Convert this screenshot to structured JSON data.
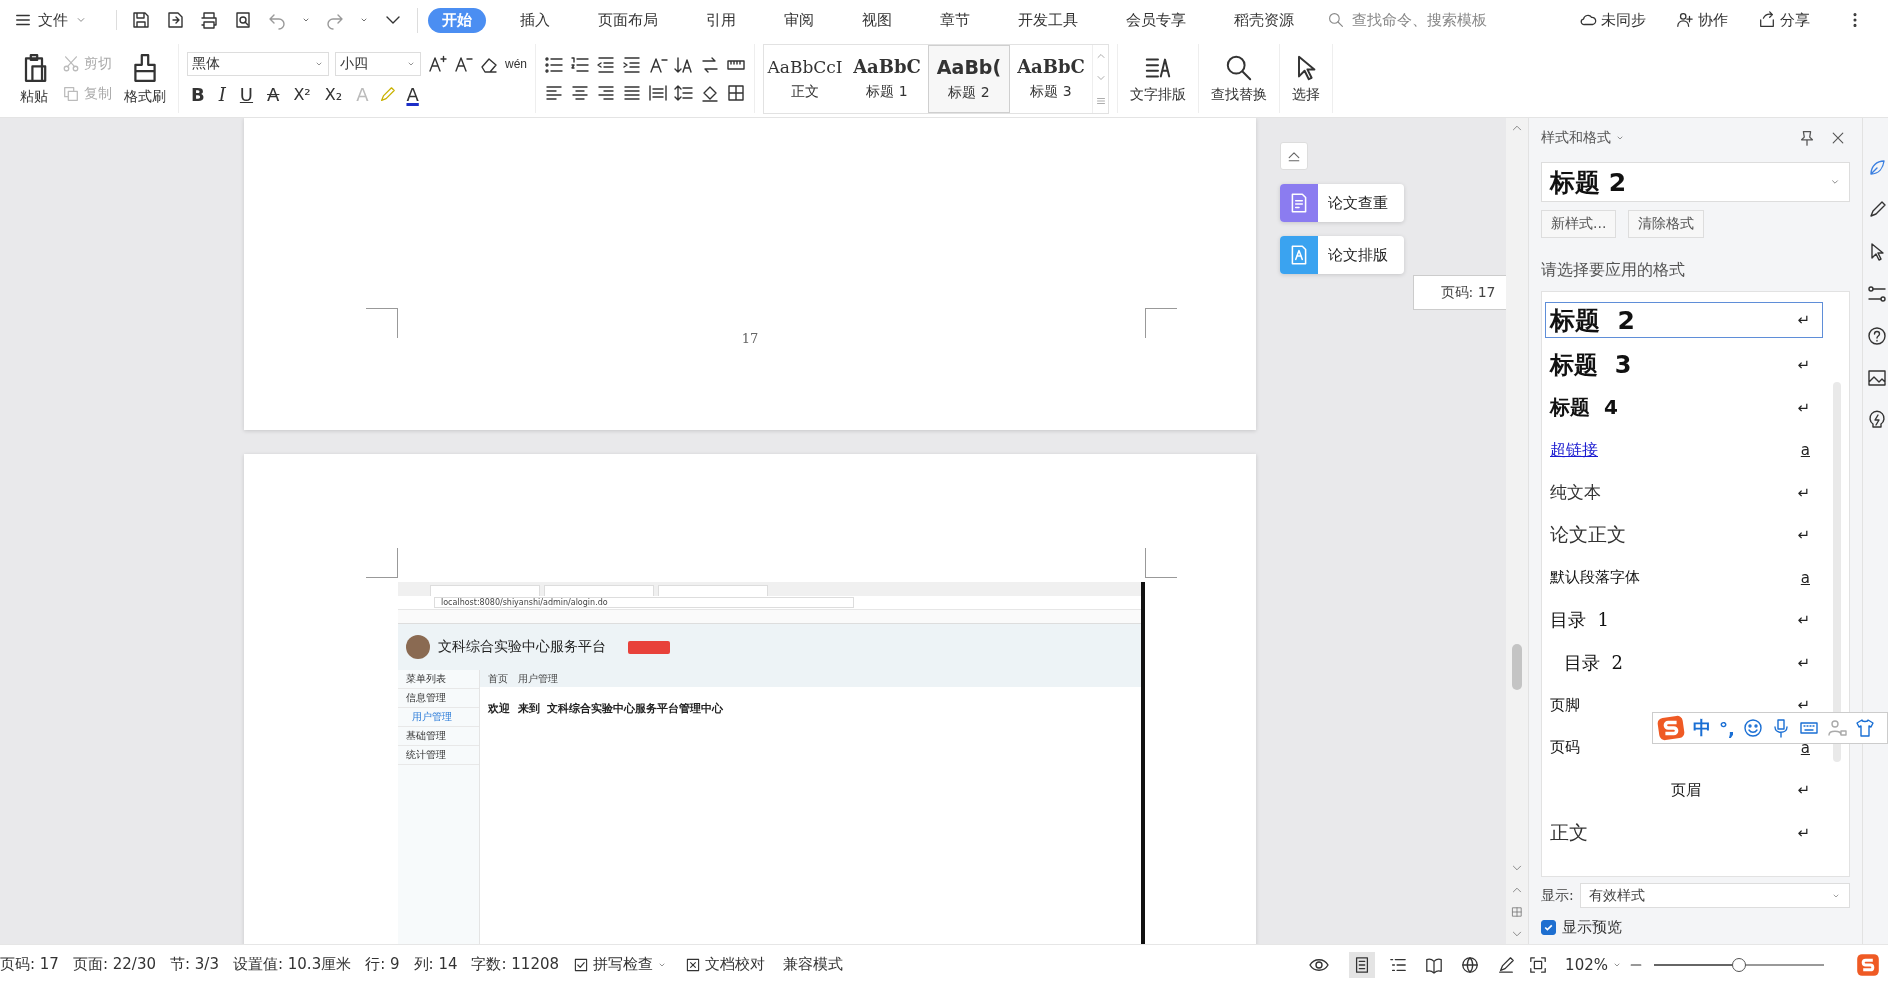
{
  "menu_bar": {
    "file_menu": "文件",
    "tabs": [
      {
        "label": "开始",
        "selected": true
      },
      {
        "label": "插入",
        "selected": false
      },
      {
        "label": "页面布局",
        "selected": false
      },
      {
        "label": "引用",
        "selected": false
      },
      {
        "label": "审阅",
        "selected": false
      },
      {
        "label": "视图",
        "selected": false
      },
      {
        "label": "章节",
        "selected": false
      },
      {
        "label": "开发工具",
        "selected": false
      },
      {
        "label": "会员专享",
        "selected": false
      },
      {
        "label": "稻壳资源",
        "selected": false
      }
    ],
    "search": {
      "placeholder": "查找命令、搜索模板"
    },
    "actions": [
      {
        "kind": "cloud",
        "label": "未同步"
      },
      {
        "kind": "collab",
        "label": "协作"
      },
      {
        "kind": "share",
        "label": "分享"
      }
    ]
  },
  "ribbon": {
    "clipboard": [
      {
        "kind": "paste",
        "label": "粘贴",
        "disabled": false
      },
      {
        "kind": "cut",
        "label": "剪切",
        "disabled": true
      },
      {
        "kind": "copy",
        "label": "复制",
        "disabled": true
      },
      {
        "kind": "painter",
        "label": "格式刷",
        "disabled": false
      }
    ],
    "font": {
      "name": "黑体",
      "size": "小四"
    },
    "phonetic": "wén",
    "format_glyphs": [
      "B",
      "I",
      "U",
      "A",
      "X²",
      "X₂",
      "A",
      "A"
    ],
    "styles": [
      {
        "preview": "AaBbCcI",
        "label": "正文",
        "kind": "body",
        "selected": false
      },
      {
        "preview": "AaBbC",
        "label": "标题 1",
        "kind": "h1",
        "selected": false
      },
      {
        "preview": "AaBb(",
        "label": "标题 2",
        "kind": "h2",
        "selected": true
      },
      {
        "preview": "AaBbC",
        "label": "标题 3",
        "kind": "h3",
        "selected": false
      }
    ],
    "buttons": [
      {
        "kind": "layout",
        "label": "文字排版"
      },
      {
        "kind": "find",
        "label": "查找替换"
      },
      {
        "kind": "select",
        "label": "选择"
      }
    ]
  },
  "document": {
    "page_number": "17",
    "side_tools": [
      {
        "kind": "check",
        "label": "论文查重"
      },
      {
        "kind": "format",
        "label": "论文排版"
      }
    ],
    "tooltip": "页码: 17",
    "screenshot": {
      "url": "localhost:8080/shiyanshi/admin/alogin.do",
      "site_title": "文科综合实验中心服务平台",
      "breadcrumb": [
        "首页",
        "用户管理"
      ],
      "menu": [
        {
          "label": "菜单列表",
          "selected": false
        },
        {
          "label": "信息管理",
          "selected": false
        },
        {
          "label": "用户管理",
          "selected": true
        },
        {
          "label": "基础管理",
          "selected": false
        },
        {
          "label": "统计管理",
          "selected": false
        }
      ],
      "welcome": "欢迎  来到  文科综合实验中心服务平台管理中心"
    }
  },
  "styles_panel": {
    "title": "样式和格式",
    "current_style": "标题  2",
    "buttons": [
      "新样式...",
      "清除格式"
    ],
    "prompt": "请选择要应用的格式",
    "styles": [
      {
        "label": "标题  2",
        "kind": "h2",
        "mark": "↵",
        "selected": true
      },
      {
        "label": "标题  3",
        "kind": "h3",
        "mark": "↵",
        "selected": false
      },
      {
        "label": "标题  4",
        "kind": "h4",
        "mark": "↵",
        "selected": false
      },
      {
        "label": "超链接",
        "kind": "link",
        "mark": "a",
        "selected": false
      },
      {
        "label": "纯文本",
        "kind": "serif",
        "mark": "↵",
        "selected": false
      },
      {
        "label": "论文正文",
        "kind": "serif-large",
        "mark": "↵",
        "selected": false
      },
      {
        "label": "默认段落字体",
        "kind": "plain",
        "mark": "a",
        "selected": false
      },
      {
        "label": "目录  1",
        "kind": "toc1",
        "mark": "↵",
        "selected": false
      },
      {
        "label": "目录  2",
        "kind": "toc2",
        "mark": "↵",
        "selected": false
      },
      {
        "label": "页脚",
        "kind": "plain",
        "mark": "↵",
        "selected": false
      },
      {
        "label": "页码",
        "kind": "plain",
        "mark": "a",
        "selected": false
      },
      {
        "label": "页眉",
        "kind": "center",
        "mark": "↵",
        "selected": false
      },
      {
        "label": "正文",
        "kind": "serif-large",
        "mark": "↵",
        "selected": false
      }
    ],
    "show_label": "显示:",
    "show_value": "有效样式",
    "preview": {
      "label": "显示预览",
      "checked": true
    }
  },
  "ime_toolbar": {
    "mode": "中",
    "punctuation": "°,"
  },
  "status_bar": {
    "items": [
      "页码: 17",
      "页面: 22/30",
      "节: 3/3",
      "设置值: 10.3厘米",
      "行: 9",
      "列: 14",
      "字数: 11208"
    ],
    "spell_check": "拼写检查",
    "doc_check": "文档校对",
    "compat": "兼容模式",
    "views": [
      {
        "kind": "page",
        "selected": true
      },
      {
        "kind": "outline",
        "selected": false
      },
      {
        "kind": "read",
        "selected": false
      },
      {
        "kind": "web",
        "selected": false
      },
      {
        "kind": "pen",
        "selected": false
      }
    ],
    "zoom": "102%",
    "zoom_slider": {
      "level": 0.5
    }
  }
}
